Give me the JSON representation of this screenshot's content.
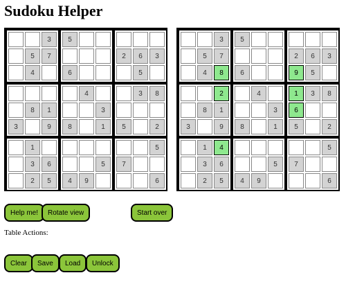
{
  "title": "Sudoku Helper",
  "boards": [
    {
      "name": "input-board",
      "cells": [
        [
          "",
          "",
          "3",
          "5",
          "",
          "",
          "",
          "",
          ""
        ],
        [
          "",
          "5",
          "7",
          "",
          "",
          "",
          "2",
          "6",
          "3"
        ],
        [
          "",
          "4",
          "",
          "6",
          "",
          "",
          "",
          "5",
          ""
        ],
        [
          "",
          "",
          "",
          "",
          "4",
          "",
          "",
          "3",
          "8"
        ],
        [
          "",
          "8",
          "1",
          "",
          "",
          "3",
          "",
          "",
          ""
        ],
        [
          "3",
          "",
          "9",
          "8",
          "",
          "1",
          "5",
          "",
          "2"
        ],
        [
          "",
          "1",
          "",
          "",
          "",
          "",
          "",
          "",
          "5"
        ],
        [
          "",
          "3",
          "6",
          "",
          "",
          "5",
          "7",
          "",
          ""
        ],
        [
          "",
          "2",
          "5",
          "4",
          "9",
          "",
          "",
          "",
          "6"
        ]
      ],
      "hints": [
        [
          "",
          "",
          "",
          "",
          "",
          "",
          "",
          "",
          ""
        ],
        [
          "",
          "",
          "",
          "",
          "",
          "",
          "",
          "",
          ""
        ],
        [
          "",
          "",
          "",
          "",
          "",
          "",
          "",
          "",
          ""
        ],
        [
          "",
          "",
          "",
          "",
          "",
          "",
          "",
          "",
          ""
        ],
        [
          "",
          "",
          "",
          "",
          "",
          "",
          "",
          "",
          ""
        ],
        [
          "",
          "",
          "",
          "",
          "",
          "",
          "",
          "",
          ""
        ],
        [
          "",
          "",
          "",
          "",
          "",
          "",
          "",
          "",
          ""
        ],
        [
          "",
          "",
          "",
          "",
          "",
          "",
          "",
          "",
          ""
        ],
        [
          "",
          "",
          "",
          "",
          "",
          "",
          "",
          "",
          ""
        ]
      ]
    },
    {
      "name": "helper-board",
      "cells": [
        [
          "",
          "",
          "3",
          "5",
          "",
          "",
          "",
          "",
          ""
        ],
        [
          "",
          "5",
          "7",
          "",
          "",
          "",
          "2",
          "6",
          "3"
        ],
        [
          "",
          "4",
          "",
          "6",
          "",
          "",
          "",
          "5",
          ""
        ],
        [
          "",
          "",
          "",
          "",
          "4",
          "",
          "",
          "3",
          "8"
        ],
        [
          "",
          "8",
          "1",
          "",
          "",
          "3",
          "",
          "",
          ""
        ],
        [
          "3",
          "",
          "9",
          "8",
          "",
          "1",
          "5",
          "",
          "2"
        ],
        [
          "",
          "1",
          "",
          "",
          "",
          "",
          "",
          "",
          "5"
        ],
        [
          "",
          "3",
          "6",
          "",
          "",
          "5",
          "7",
          "",
          ""
        ],
        [
          "",
          "2",
          "5",
          "4",
          "9",
          "",
          "",
          "",
          "6"
        ]
      ],
      "hints": [
        [
          "",
          "",
          "",
          "",
          "",
          "",
          "",
          "",
          ""
        ],
        [
          "",
          "",
          "",
          "",
          "",
          "",
          "",
          "",
          ""
        ],
        [
          "",
          "",
          "8",
          "",
          "",
          "",
          "9",
          "",
          ""
        ],
        [
          "",
          "",
          "2",
          "",
          "",
          "",
          "1",
          "",
          ""
        ],
        [
          "",
          "",
          "",
          "",
          "",
          "",
          "6",
          "",
          ""
        ],
        [
          "",
          "",
          "",
          "",
          "",
          "",
          "",
          "",
          ""
        ],
        [
          "",
          "",
          "4",
          "",
          "",
          "",
          "",
          "",
          ""
        ],
        [
          "",
          "",
          "",
          "",
          "",
          "",
          "",
          "",
          ""
        ],
        [
          "",
          "",
          "",
          "",
          "",
          "",
          "",
          "",
          ""
        ]
      ]
    }
  ],
  "controls": {
    "help_label": "Help me!",
    "rotate_label": "Rotate view",
    "start_over_label": "Start over"
  },
  "table_actions": {
    "label": "Table Actions:",
    "clear_label": "Clear",
    "save_label": "Save",
    "load_label": "Load",
    "unlock_label": "Unlock"
  },
  "colors": {
    "button_fill": "#8bc53a",
    "given_cell": "#d3d3d3",
    "hint_cell": "#8ee88e",
    "grid_line": "#000000"
  }
}
